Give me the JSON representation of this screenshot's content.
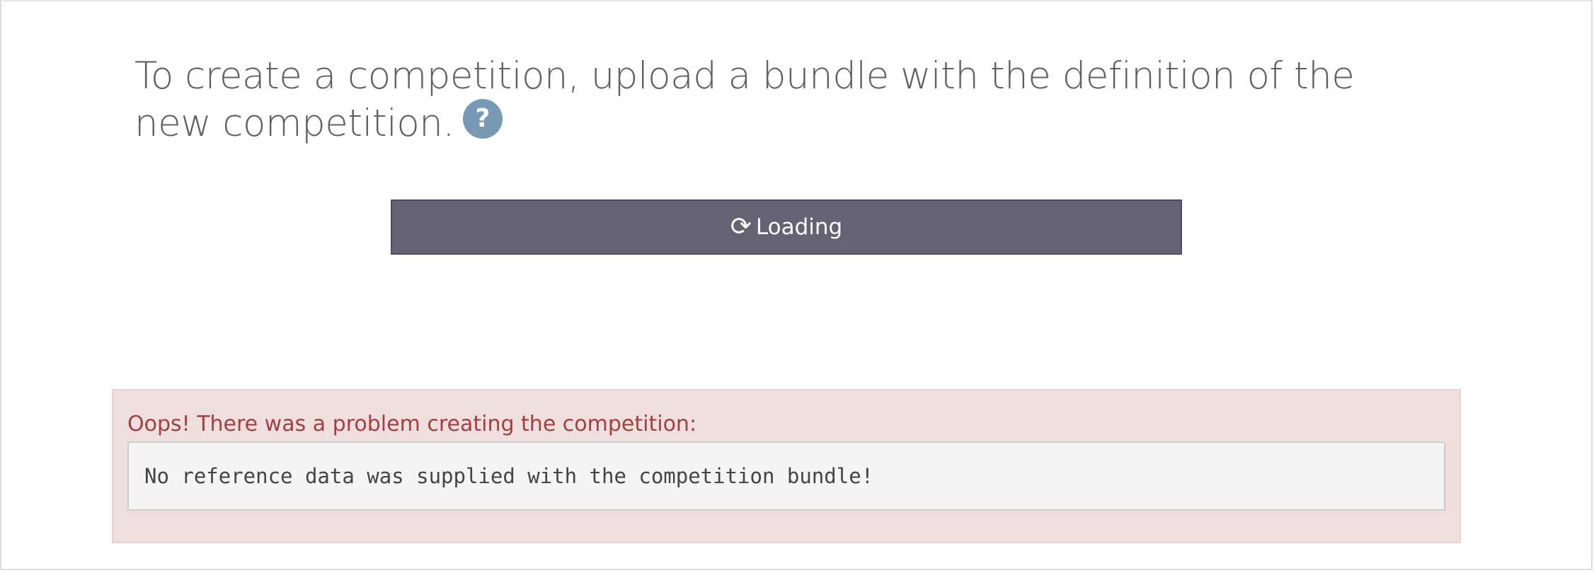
{
  "upload": {
    "heading": "To create a competition, upload a bundle with the definition of the new competition.",
    "help_icon": "question-circle-icon",
    "help_glyph": "?",
    "button": {
      "icon": "refresh-icon",
      "icon_glyph": "⟳",
      "label": "Loading"
    }
  },
  "error": {
    "title": "Oops! There was a problem creating the competition:",
    "message": "No reference data was supplied with the competition bundle!"
  },
  "colors": {
    "button_bg": "#646273",
    "help_icon_bg": "#7799b4",
    "error_bg": "#efdede",
    "error_text": "#a3403f"
  }
}
